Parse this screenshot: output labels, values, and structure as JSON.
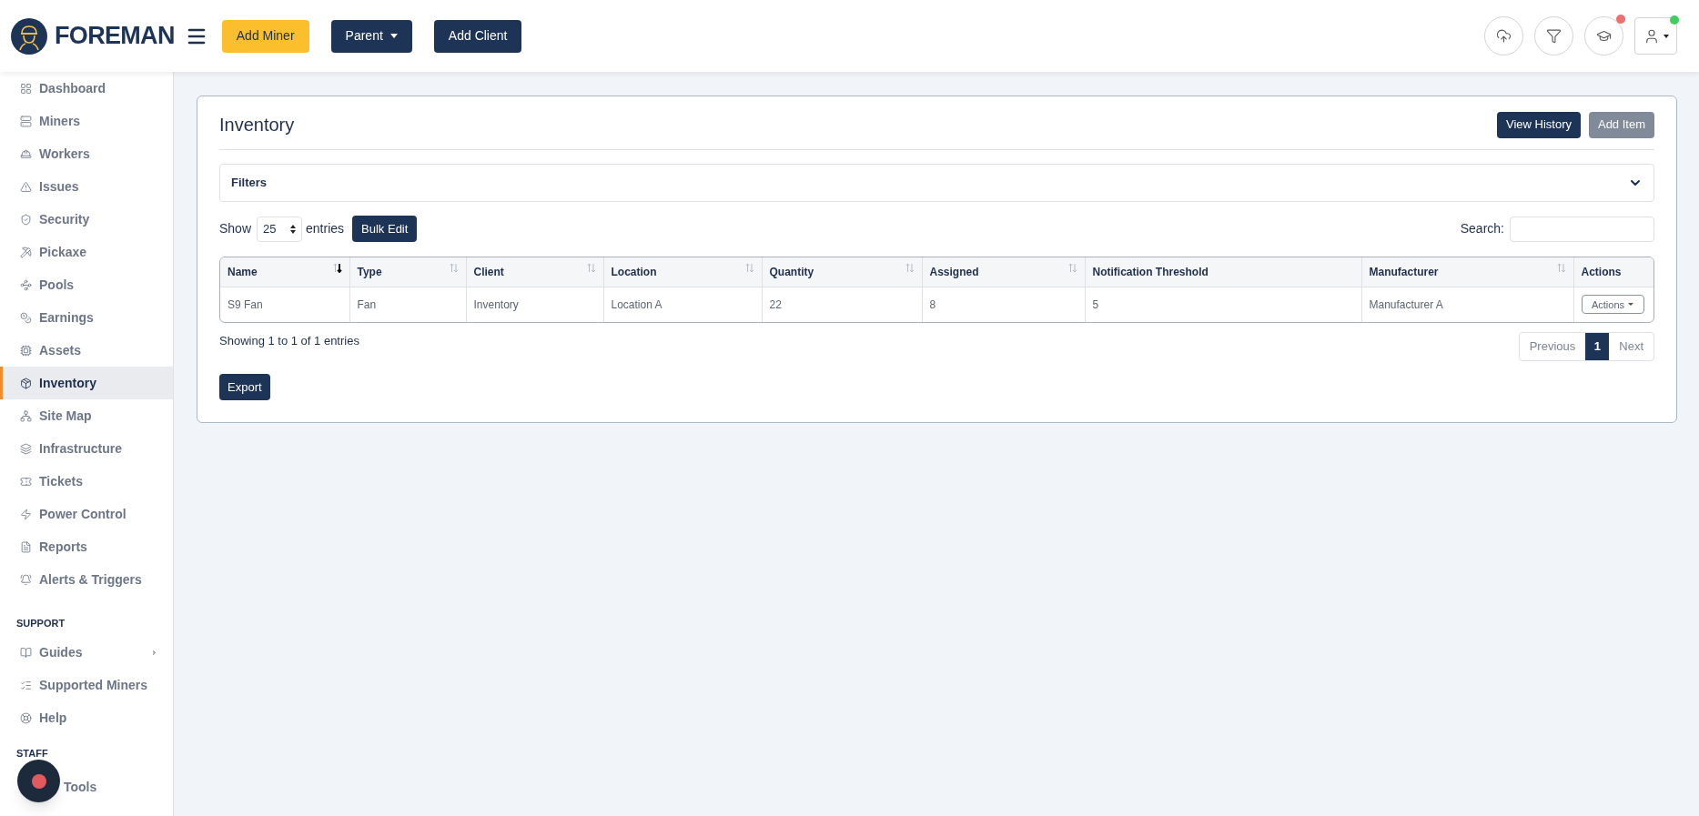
{
  "header": {
    "brand": "FOREMAN",
    "buttons": [
      {
        "label": "Add Miner",
        "kind": "accent",
        "dropdown": false
      },
      {
        "label": "Parent",
        "kind": "primary",
        "dropdown": true
      },
      {
        "label": "Add Client",
        "kind": "primary",
        "dropdown": false
      }
    ],
    "icons": [
      {
        "kind": "upload"
      },
      {
        "kind": "filter"
      },
      {
        "kind": "learn",
        "color": "#f26d6d"
      },
      {
        "kind": "user",
        "color": "#3ecf5f"
      }
    ]
  },
  "sidebar": {
    "items": [
      {
        "label": "Dashboard",
        "selected": false
      },
      {
        "label": "Miners",
        "selected": false
      },
      {
        "label": "Workers",
        "selected": false
      },
      {
        "label": "Issues",
        "selected": false
      },
      {
        "label": "Security",
        "selected": false
      },
      {
        "label": "Pickaxe",
        "selected": false
      },
      {
        "label": "Pools",
        "selected": false
      },
      {
        "label": "Earnings",
        "selected": false
      },
      {
        "label": "Assets",
        "selected": false
      },
      {
        "label": "Inventory",
        "selected": true
      },
      {
        "label": "Site Map",
        "selected": false
      },
      {
        "label": "Infrastructure",
        "selected": false
      },
      {
        "label": "Tickets",
        "selected": false
      },
      {
        "label": "Power Control",
        "selected": false
      },
      {
        "label": "Reports",
        "selected": false
      },
      {
        "label": "Alerts & Triggers",
        "selected": false
      }
    ],
    "support_heading": "SUPPORT",
    "support_items": [
      {
        "label": "Guides",
        "expandable": true
      },
      {
        "label": "Supported Miners",
        "expandable": false
      },
      {
        "label": "Help",
        "expandable": false
      }
    ],
    "staff_heading": "STAFF",
    "staff_item": "Tools"
  },
  "card": {
    "title": "Inventory",
    "buttons": [
      {
        "label": "View History",
        "disabled": false
      },
      {
        "label": "Add Item",
        "disabled": true
      }
    ],
    "filters": {
      "label": "Filters",
      "expanded": false
    },
    "show_label": "Show",
    "page_size": "25",
    "entries_label": "entries",
    "bulk_edit": "Bulk Edit",
    "search_label": "Search:",
    "table": {
      "columns": [
        {
          "label": "Name",
          "sortable": true,
          "sorted": true
        },
        {
          "label": "Type",
          "sortable": true,
          "sorted": false
        },
        {
          "label": "Client",
          "sortable": true,
          "sorted": false
        },
        {
          "label": "Location",
          "sortable": true,
          "sorted": false
        },
        {
          "label": "Quantity",
          "sortable": true,
          "sorted": false
        },
        {
          "label": "Assigned",
          "sortable": true,
          "sorted": false
        },
        {
          "label": "Notification Threshold",
          "sortable": false,
          "sorted": false
        },
        {
          "label": "Manufacturer",
          "sortable": true,
          "sorted": false
        },
        {
          "label": "Actions",
          "sortable": false,
          "sorted": false
        }
      ],
      "rows": [
        {
          "cells": [
            "S9 Fan",
            "Fan",
            "Inventory",
            "Location A",
            "22",
            "8",
            "5",
            "Manufacturer A"
          ],
          "action": "Actions"
        }
      ]
    },
    "info": "Showing 1 to 1 of 1 entries",
    "pagination": [
      {
        "label": "Previous",
        "kind": "nav",
        "selected": false
      },
      {
        "label": "1",
        "kind": "page",
        "selected": true
      },
      {
        "label": "Next",
        "kind": "nav",
        "selected": false
      }
    ],
    "export": "Export"
  }
}
